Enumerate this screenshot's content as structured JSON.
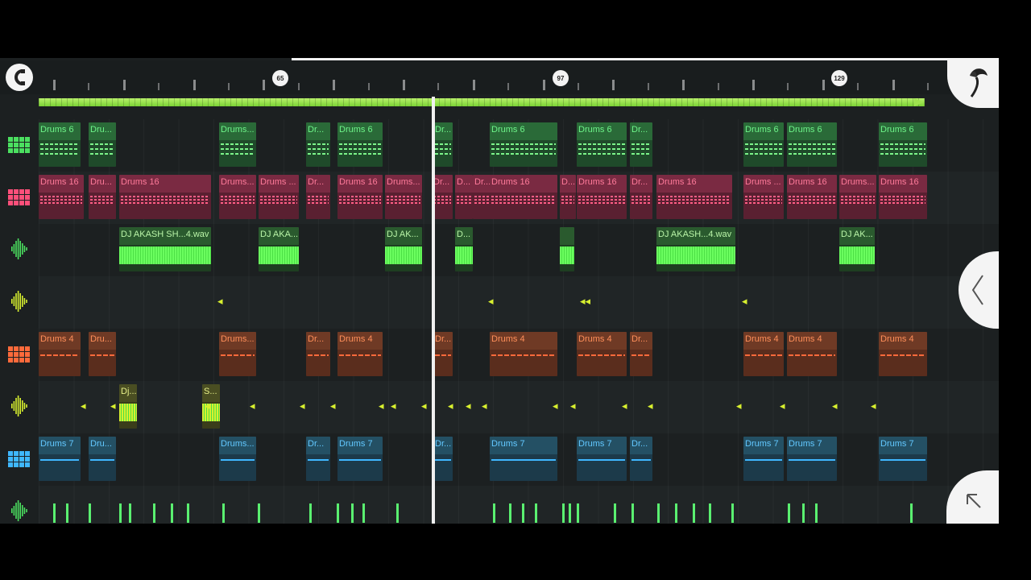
{
  "timeline": {
    "markers": [
      "65",
      "97",
      "129"
    ]
  },
  "controls": {
    "snap_icon": "snap-magnet-icon",
    "logo_icon": "fl-studio-fruit-icon",
    "collapse_icon": "chevron-left-icon",
    "corner_icon": "arrow-up-left-icon"
  },
  "colors": {
    "drums6": "#4be060",
    "drums16": "#ff4f7a",
    "audio": "#6bff5f",
    "drums4": "#ff6a3b",
    "drums7": "#3fb7ff",
    "transients": "#d8f02f"
  },
  "lanes": [
    {
      "type": "pattern",
      "icon": "green-step-sequencer-icon",
      "clips": [
        {
          "label": "Drums 6"
        },
        {
          "label": "Dru..."
        },
        {
          "label": "Drums..."
        },
        {
          "label": "Dr..."
        },
        {
          "label": "Drums 6"
        },
        {
          "label": "Dr..."
        },
        {
          "label": "Drums 6"
        },
        {
          "label": "Drums 6"
        },
        {
          "label": "Dr..."
        },
        {
          "label": "Drums 6"
        },
        {
          "label": "Drums 6"
        },
        {
          "label": "Drums 6"
        }
      ]
    },
    {
      "type": "pattern",
      "icon": "pink-step-sequencer-icon",
      "clips": [
        {
          "label": "Drums 16"
        },
        {
          "label": "Dru..."
        },
        {
          "label": "Drums 16"
        },
        {
          "label": "Drums..."
        },
        {
          "label": "Drums ..."
        },
        {
          "label": "Dr..."
        },
        {
          "label": "Drums 16"
        },
        {
          "label": "Drums..."
        },
        {
          "label": "Dr..."
        },
        {
          "label": "D..."
        },
        {
          "label": "Dr..."
        },
        {
          "label": "Drums 16"
        },
        {
          "label": "D..."
        },
        {
          "label": "Drums 16"
        },
        {
          "label": "Dr..."
        },
        {
          "label": "Drums 16"
        },
        {
          "label": "Drums ..."
        },
        {
          "label": "Drums 16"
        },
        {
          "label": "Drums..."
        },
        {
          "label": "Drums 16"
        }
      ]
    },
    {
      "type": "audio",
      "icon": "green-waveform-icon",
      "clips": [
        {
          "label": "DJ AKASH SH...4.wav"
        },
        {
          "label": "DJ AKA..."
        },
        {
          "label": "DJ AK..."
        },
        {
          "label": "D..."
        },
        {
          "label": ""
        },
        {
          "label": "DJ AKASH...4.wav"
        },
        {
          "label": "DJ AK..."
        }
      ]
    },
    {
      "type": "audio",
      "icon": "yellow-waveform-icon",
      "clips": []
    },
    {
      "type": "pattern",
      "icon": "orange-step-sequencer-icon",
      "clips": [
        {
          "label": "Drums 4"
        },
        {
          "label": "Dru..."
        },
        {
          "label": "Drums..."
        },
        {
          "label": "Dr..."
        },
        {
          "label": "Drums 4"
        },
        {
          "label": "Dr..."
        },
        {
          "label": "Drums 4"
        },
        {
          "label": "Drums 4"
        },
        {
          "label": "Dr..."
        },
        {
          "label": "Drums 4"
        },
        {
          "label": "Drums 4"
        },
        {
          "label": "Drums 4"
        }
      ]
    },
    {
      "type": "audio",
      "icon": "yellow-waveform-icon",
      "clips": [
        {
          "label": "Dj..."
        },
        {
          "label": "S..."
        }
      ]
    },
    {
      "type": "pattern",
      "icon": "blue-step-sequencer-icon",
      "clips": [
        {
          "label": "Drums 7"
        },
        {
          "label": "Dru..."
        },
        {
          "label": "Drums..."
        },
        {
          "label": "Dr..."
        },
        {
          "label": "Drums 7"
        },
        {
          "label": "Dr..."
        },
        {
          "label": "Drums 7"
        },
        {
          "label": "Drums 7"
        },
        {
          "label": "Dr..."
        },
        {
          "label": "Drums 7"
        },
        {
          "label": "Drums 7"
        },
        {
          "label": "Drums 7"
        }
      ]
    },
    {
      "type": "audio",
      "icon": "green-waveform-icon",
      "clips": []
    }
  ]
}
